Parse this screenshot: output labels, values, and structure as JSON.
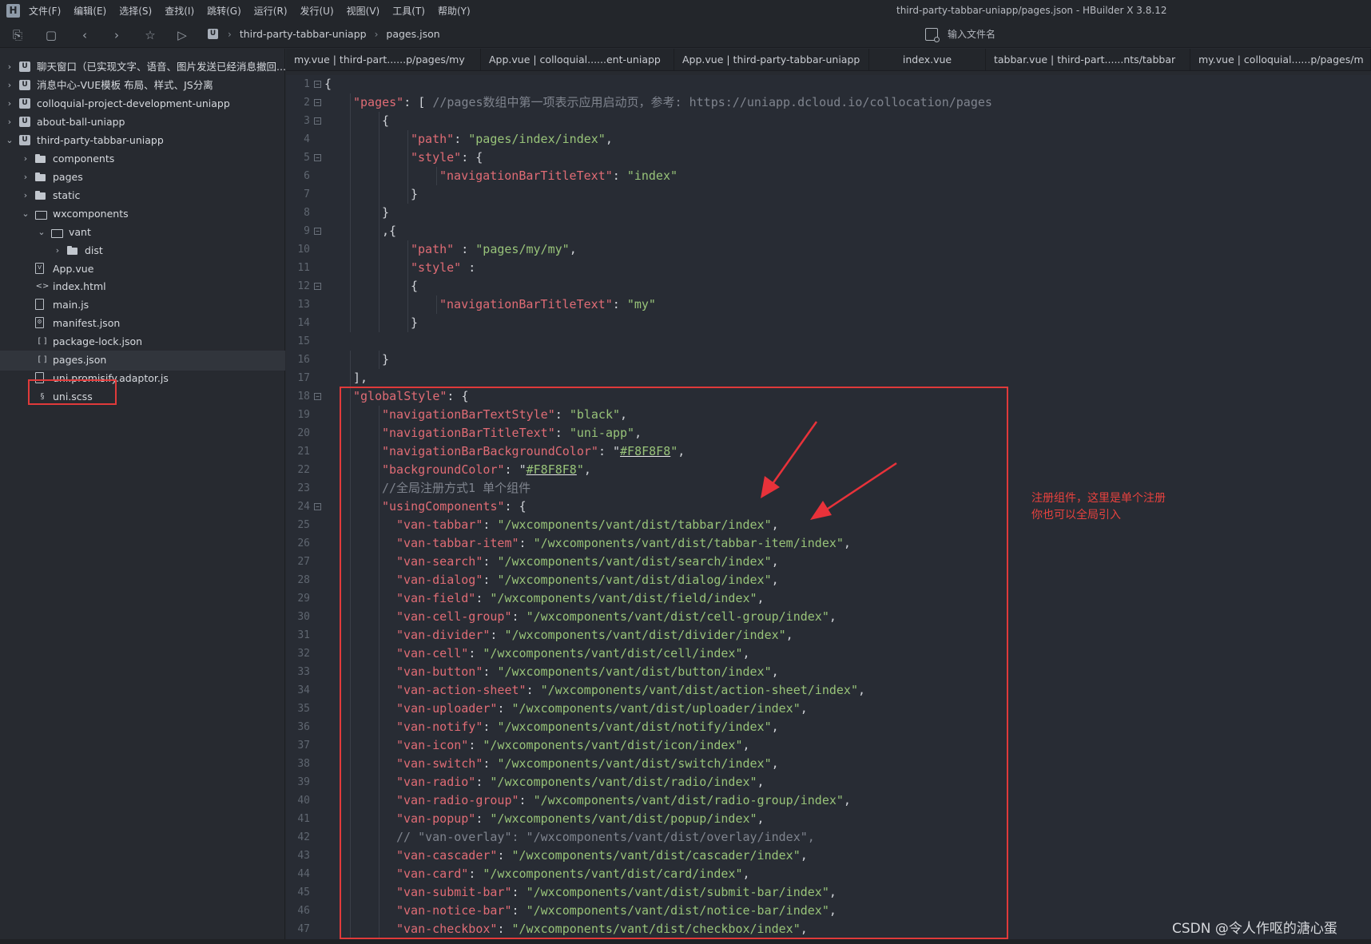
{
  "menubar": {
    "logo": "H",
    "items": [
      "文件(F)",
      "编辑(E)",
      "选择(S)",
      "查找(I)",
      "跳转(G)",
      "运行(R)",
      "发行(U)",
      "视图(V)",
      "工具(T)",
      "帮助(Y)"
    ],
    "window_title": "third-party-tabbar-uniapp/pages.json - HBuilder X 3.8.12"
  },
  "toolbar": {
    "icons": [
      "new-file-icon",
      "save-icon",
      "back-icon",
      "forward-icon",
      "star-icon",
      "run-icon"
    ],
    "breadcrumb": [
      "third-party-tabbar-uniapp",
      "pages.json"
    ],
    "file_search_placeholder": "输入文件名"
  },
  "sidebar": {
    "items": [
      {
        "label": "聊天窗口（已实现文字、语音、图片发送已经消息撤回...",
        "type": "project",
        "depth": 0,
        "expanded": false
      },
      {
        "label": "消息中心-VUE模板 布局、样式、JS分离",
        "type": "project",
        "depth": 0,
        "expanded": false
      },
      {
        "label": "colloquial-project-development-uniapp",
        "type": "project",
        "depth": 0,
        "expanded": false
      },
      {
        "label": "about-ball-uniapp",
        "type": "project",
        "depth": 0,
        "expanded": false
      },
      {
        "label": "third-party-tabbar-uniapp",
        "type": "project",
        "depth": 0,
        "expanded": true
      },
      {
        "label": "components",
        "type": "folder",
        "depth": 1,
        "expanded": false
      },
      {
        "label": "pages",
        "type": "folder",
        "depth": 1,
        "expanded": false
      },
      {
        "label": "static",
        "type": "folder",
        "depth": 1,
        "expanded": false
      },
      {
        "label": "wxcomponents",
        "type": "folder-open",
        "depth": 1,
        "expanded": true
      },
      {
        "label": "vant",
        "type": "folder-open",
        "depth": 2,
        "expanded": true
      },
      {
        "label": "dist",
        "type": "folder",
        "depth": 3,
        "expanded": false
      },
      {
        "label": "App.vue",
        "type": "file",
        "glyph": "V",
        "depth": 1
      },
      {
        "label": "index.html",
        "type": "file-html",
        "glyph": "<>",
        "depth": 1
      },
      {
        "label": "main.js",
        "type": "file",
        "glyph": "",
        "depth": 1
      },
      {
        "label": "manifest.json",
        "type": "file",
        "glyph": "⚙",
        "depth": 1
      },
      {
        "label": "package-lock.json",
        "type": "file-json",
        "glyph": "[ ]",
        "depth": 1
      },
      {
        "label": "pages.json",
        "type": "file-json",
        "glyph": "[ ]",
        "depth": 1,
        "selected": true
      },
      {
        "label": "uni.promisify.adaptor.js",
        "type": "file",
        "glyph": "",
        "depth": 1
      },
      {
        "label": "uni.scss",
        "type": "file-scss",
        "glyph": "§",
        "depth": 1
      }
    ],
    "footer_icons": [
      "explorer-icon",
      "extensions-icon",
      "debug-icon",
      "git-icon",
      "plugin-icon"
    ]
  },
  "tabs": [
    "my.vue | third-part......p/pages/my",
    "App.vue | colloquial......ent-uniapp",
    "App.vue | third-party-tabbar-uniapp",
    "index.vue",
    "tabbar.vue | third-part......nts/tabbar",
    "my.vue | colloquial......p/pages/m"
  ],
  "active_tab": "pages.json",
  "editor": {
    "lines": [
      {
        "n": "1",
        "fold": true,
        "indent": 0,
        "tokens": [
          [
            "pun",
            "{"
          ]
        ]
      },
      {
        "n": "2",
        "fold": true,
        "indent": 1,
        "tokens": [
          [
            "key",
            "\"pages\""
          ],
          [
            "pun",
            ": [ "
          ],
          [
            "com",
            "//pages数组中第一项表示应用启动页，参考: https://uniapp.dcloud.io/collocation/pages"
          ]
        ]
      },
      {
        "n": "3",
        "fold": true,
        "indent": 2,
        "tokens": [
          [
            "pun",
            "{"
          ]
        ]
      },
      {
        "n": "4",
        "fold": false,
        "indent": 3,
        "tokens": [
          [
            "key",
            "\"path\""
          ],
          [
            "pun",
            ": "
          ],
          [
            "str",
            "\"pages/index/index\""
          ],
          [
            "pun",
            ","
          ]
        ]
      },
      {
        "n": "5",
        "fold": true,
        "indent": 3,
        "tokens": [
          [
            "key",
            "\"style\""
          ],
          [
            "pun",
            ": {"
          ]
        ]
      },
      {
        "n": "6",
        "fold": false,
        "indent": 4,
        "tokens": [
          [
            "key",
            "\"navigationBarTitleText\""
          ],
          [
            "pun",
            ": "
          ],
          [
            "str",
            "\"index\""
          ]
        ]
      },
      {
        "n": "7",
        "fold": false,
        "indent": 3,
        "tokens": [
          [
            "pun",
            "}"
          ]
        ]
      },
      {
        "n": "8",
        "fold": false,
        "indent": 2,
        "tokens": [
          [
            "pun",
            "}"
          ]
        ]
      },
      {
        "n": "9",
        "fold": true,
        "indent": 2,
        "tokens": [
          [
            "pun",
            ",{"
          ]
        ]
      },
      {
        "n": "10",
        "fold": false,
        "indent": 3,
        "tokens": [
          [
            "key",
            "\"path\""
          ],
          [
            "pun",
            " : "
          ],
          [
            "str",
            "\"pages/my/my\""
          ],
          [
            "pun",
            ","
          ]
        ]
      },
      {
        "n": "11",
        "fold": false,
        "indent": 3,
        "tokens": [
          [
            "key",
            "\"style\""
          ],
          [
            "pun",
            " :"
          ]
        ]
      },
      {
        "n": "12",
        "fold": true,
        "indent": 3,
        "tokens": [
          [
            "pun",
            "{"
          ]
        ]
      },
      {
        "n": "13",
        "fold": false,
        "indent": 4,
        "tokens": [
          [
            "key",
            "\"navigationBarTitleText\""
          ],
          [
            "pun",
            ": "
          ],
          [
            "str",
            "\"my\""
          ]
        ]
      },
      {
        "n": "14",
        "fold": false,
        "indent": 3,
        "tokens": [
          [
            "pun",
            "}"
          ]
        ]
      },
      {
        "n": "15",
        "fold": false,
        "indent": 0,
        "tokens": []
      },
      {
        "n": "16",
        "fold": false,
        "indent": 2,
        "tokens": [
          [
            "pun",
            "}"
          ]
        ]
      },
      {
        "n": "17",
        "fold": false,
        "indent": 1,
        "tokens": [
          [
            "pun",
            "],"
          ]
        ]
      },
      {
        "n": "18",
        "fold": true,
        "indent": 1,
        "tokens": [
          [
            "key",
            "\"globalStyle\""
          ],
          [
            "pun",
            ": {"
          ]
        ]
      },
      {
        "n": "19",
        "fold": false,
        "indent": 2,
        "tokens": [
          [
            "key",
            "\"navigationBarTextStyle\""
          ],
          [
            "pun",
            ": "
          ],
          [
            "str",
            "\"black\""
          ],
          [
            "pun",
            ","
          ]
        ]
      },
      {
        "n": "20",
        "fold": false,
        "indent": 2,
        "tokens": [
          [
            "key",
            "\"navigationBarTitleText\""
          ],
          [
            "pun",
            ": "
          ],
          [
            "str",
            "\"uni-app\""
          ],
          [
            "pun",
            ","
          ]
        ]
      },
      {
        "n": "21",
        "fold": false,
        "indent": 2,
        "tokens": [
          [
            "key",
            "\"navigationBarBackgroundColor\""
          ],
          [
            "pun",
            ": \""
          ],
          [
            "stru",
            "#F8F8F8"
          ],
          [
            "str",
            "\""
          ],
          [
            "pun",
            ","
          ]
        ]
      },
      {
        "n": "22",
        "fold": false,
        "indent": 2,
        "tokens": [
          [
            "key",
            "\"backgroundColor\""
          ],
          [
            "pun",
            ": \""
          ],
          [
            "stru",
            "#F8F8F8"
          ],
          [
            "str",
            "\""
          ],
          [
            "pun",
            ","
          ]
        ]
      },
      {
        "n": "23",
        "fold": false,
        "indent": 2,
        "tokens": [
          [
            "com",
            "//全局注册方式1 单个组件"
          ]
        ]
      },
      {
        "n": "24",
        "fold": true,
        "indent": 2,
        "tokens": [
          [
            "key",
            "\"usingComponents\""
          ],
          [
            "pun",
            ": {"
          ]
        ]
      },
      {
        "n": "25",
        "fold": false,
        "indent": 2.5,
        "tokens": [
          [
            "key",
            "\"van-tabbar\""
          ],
          [
            "pun",
            ": "
          ],
          [
            "str",
            "\"/wxcomponents/vant/dist/tabbar/index\""
          ],
          [
            "pun",
            ","
          ]
        ]
      },
      {
        "n": "26",
        "fold": false,
        "indent": 2.5,
        "tokens": [
          [
            "key",
            "\"van-tabbar-item\""
          ],
          [
            "pun",
            ": "
          ],
          [
            "str",
            "\"/wxcomponents/vant/dist/tabbar-item/index\""
          ],
          [
            "pun",
            ","
          ]
        ]
      },
      {
        "n": "27",
        "fold": false,
        "indent": 2.5,
        "tokens": [
          [
            "key",
            "\"van-search\""
          ],
          [
            "pun",
            ": "
          ],
          [
            "str",
            "\"/wxcomponents/vant/dist/search/index\""
          ],
          [
            "pun",
            ","
          ]
        ]
      },
      {
        "n": "28",
        "fold": false,
        "indent": 2.5,
        "tokens": [
          [
            "key",
            "\"van-dialog\""
          ],
          [
            "pun",
            ": "
          ],
          [
            "str",
            "\"/wxcomponents/vant/dist/dialog/index\""
          ],
          [
            "pun",
            ","
          ]
        ]
      },
      {
        "n": "29",
        "fold": false,
        "indent": 2.5,
        "tokens": [
          [
            "key",
            "\"van-field\""
          ],
          [
            "pun",
            ": "
          ],
          [
            "str",
            "\"/wxcomponents/vant/dist/field/index\""
          ],
          [
            "pun",
            ","
          ]
        ]
      },
      {
        "n": "30",
        "fold": false,
        "indent": 2.5,
        "tokens": [
          [
            "key",
            "\"van-cell-group\""
          ],
          [
            "pun",
            ": "
          ],
          [
            "str",
            "\"/wxcomponents/vant/dist/cell-group/index\""
          ],
          [
            "pun",
            ","
          ]
        ]
      },
      {
        "n": "31",
        "fold": false,
        "indent": 2.5,
        "tokens": [
          [
            "key",
            "\"van-divider\""
          ],
          [
            "pun",
            ": "
          ],
          [
            "str",
            "\"/wxcomponents/vant/dist/divider/index\""
          ],
          [
            "pun",
            ","
          ]
        ]
      },
      {
        "n": "32",
        "fold": false,
        "indent": 2.5,
        "tokens": [
          [
            "key",
            "\"van-cell\""
          ],
          [
            "pun",
            ": "
          ],
          [
            "str",
            "\"/wxcomponents/vant/dist/cell/index\""
          ],
          [
            "pun",
            ","
          ]
        ]
      },
      {
        "n": "33",
        "fold": false,
        "indent": 2.5,
        "tokens": [
          [
            "key",
            "\"van-button\""
          ],
          [
            "pun",
            ": "
          ],
          [
            "str",
            "\"/wxcomponents/vant/dist/button/index\""
          ],
          [
            "pun",
            ","
          ]
        ]
      },
      {
        "n": "34",
        "fold": false,
        "indent": 2.5,
        "tokens": [
          [
            "key",
            "\"van-action-sheet\""
          ],
          [
            "pun",
            ": "
          ],
          [
            "str",
            "\"/wxcomponents/vant/dist/action-sheet/index\""
          ],
          [
            "pun",
            ","
          ]
        ]
      },
      {
        "n": "35",
        "fold": false,
        "indent": 2.5,
        "tokens": [
          [
            "key",
            "\"van-uploader\""
          ],
          [
            "pun",
            ": "
          ],
          [
            "str",
            "\"/wxcomponents/vant/dist/uploader/index\""
          ],
          [
            "pun",
            ","
          ]
        ]
      },
      {
        "n": "36",
        "fold": false,
        "indent": 2.5,
        "tokens": [
          [
            "key",
            "\"van-notify\""
          ],
          [
            "pun",
            ": "
          ],
          [
            "str",
            "\"/wxcomponents/vant/dist/notify/index\""
          ],
          [
            "pun",
            ","
          ]
        ]
      },
      {
        "n": "37",
        "fold": false,
        "indent": 2.5,
        "tokens": [
          [
            "key",
            "\"van-icon\""
          ],
          [
            "pun",
            ": "
          ],
          [
            "str",
            "\"/wxcomponents/vant/dist/icon/index\""
          ],
          [
            "pun",
            ","
          ]
        ]
      },
      {
        "n": "38",
        "fold": false,
        "indent": 2.5,
        "tokens": [
          [
            "key",
            "\"van-switch\""
          ],
          [
            "pun",
            ": "
          ],
          [
            "str",
            "\"/wxcomponents/vant/dist/switch/index\""
          ],
          [
            "pun",
            ","
          ]
        ]
      },
      {
        "n": "39",
        "fold": false,
        "indent": 2.5,
        "tokens": [
          [
            "key",
            "\"van-radio\""
          ],
          [
            "pun",
            ": "
          ],
          [
            "str",
            "\"/wxcomponents/vant/dist/radio/index\""
          ],
          [
            "pun",
            ","
          ]
        ]
      },
      {
        "n": "40",
        "fold": false,
        "indent": 2.5,
        "tokens": [
          [
            "key",
            "\"van-radio-group\""
          ],
          [
            "pun",
            ": "
          ],
          [
            "str",
            "\"/wxcomponents/vant/dist/radio-group/index\""
          ],
          [
            "pun",
            ","
          ]
        ]
      },
      {
        "n": "41",
        "fold": false,
        "indent": 2.5,
        "tokens": [
          [
            "key",
            "\"van-popup\""
          ],
          [
            "pun",
            ": "
          ],
          [
            "str",
            "\"/wxcomponents/vant/dist/popup/index\""
          ],
          [
            "pun",
            ","
          ]
        ]
      },
      {
        "n": "42",
        "fold": false,
        "indent": 2.5,
        "tokens": [
          [
            "com",
            "// \"van-overlay\": \"/wxcomponents/vant/dist/overlay/index\","
          ]
        ]
      },
      {
        "n": "43",
        "fold": false,
        "indent": 2.5,
        "tokens": [
          [
            "key",
            "\"van-cascader\""
          ],
          [
            "pun",
            ": "
          ],
          [
            "str",
            "\"/wxcomponents/vant/dist/cascader/index\""
          ],
          [
            "pun",
            ","
          ]
        ]
      },
      {
        "n": "44",
        "fold": false,
        "indent": 2.5,
        "tokens": [
          [
            "key",
            "\"van-card\""
          ],
          [
            "pun",
            ": "
          ],
          [
            "str",
            "\"/wxcomponents/vant/dist/card/index\""
          ],
          [
            "pun",
            ","
          ]
        ]
      },
      {
        "n": "45",
        "fold": false,
        "indent": 2.5,
        "tokens": [
          [
            "key",
            "\"van-submit-bar\""
          ],
          [
            "pun",
            ": "
          ],
          [
            "str",
            "\"/wxcomponents/vant/dist/submit-bar/index\""
          ],
          [
            "pun",
            ","
          ]
        ]
      },
      {
        "n": "46",
        "fold": false,
        "indent": 2.5,
        "tokens": [
          [
            "key",
            "\"van-notice-bar\""
          ],
          [
            "pun",
            ": "
          ],
          [
            "str",
            "\"/wxcomponents/vant/dist/notice-bar/index\""
          ],
          [
            "pun",
            ","
          ]
        ]
      },
      {
        "n": "47",
        "fold": false,
        "indent": 2.5,
        "tokens": [
          [
            "key",
            "\"van-checkbox\""
          ],
          [
            "pun",
            ": "
          ],
          [
            "str",
            "\"/wxcomponents/vant/dist/checkbox/index\""
          ],
          [
            "pun",
            ","
          ]
        ]
      }
    ]
  },
  "annotation": {
    "lines": [
      "注册组件，这里是单个注册",
      "你也可以全局引入"
    ],
    "color": "#e8423e"
  },
  "watermark": "CSDN @令人作呕的溏心蛋",
  "colors": {
    "highlight_border": "#e03a3a",
    "key": "#e06c75",
    "string": "#98c379",
    "comment": "#7f848e"
  }
}
